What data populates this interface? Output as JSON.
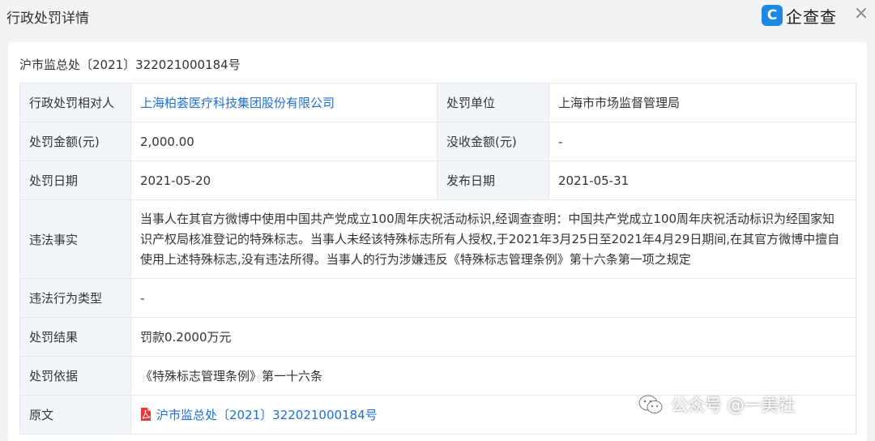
{
  "header": {
    "title": "行政处罚详情",
    "brand_name": "企查查",
    "close_glyph": "×"
  },
  "case_number": "沪市监总处〔2021〕322021000184号",
  "rows": {
    "party_label": "行政处罚相对人",
    "party_value": "上海柏荟医疗科技集团股份有限公司",
    "unit_label": "处罚单位",
    "unit_value": "上海市市场监督管理局",
    "amount_label": "处罚金额(元)",
    "amount_value": "2,000.00",
    "confiscated_label": "没收金额(元)",
    "confiscated_value": "-",
    "date_label": "处罚日期",
    "date_value": "2021-05-20",
    "publish_label": "发布日期",
    "publish_value": "2021-05-31",
    "facts_label": "违法事实",
    "facts_value": "当事人在其官方微博中使用中国共产党成立100周年庆祝活动标识,经调查查明：中国共产党成立100周年庆祝活动标识为经国家知识产权局核准登记的特殊标志。当事人未经该特殊标志所有人授权,于2021年3月25日至2021年4月29日期间,在其官方微博中擅自使用上述特殊标志,没有违法所得。当事人的行为涉嫌违反《特殊标志管理条例》第十六条第一项之规定",
    "type_label": "违法行为类型",
    "type_value": "-",
    "result_label": "处罚结果",
    "result_value": "罚款0.2000万元",
    "basis_label": "处罚依据",
    "basis_value": "《特殊标志管理条例》第一十六条",
    "original_label": "原文",
    "original_value": "沪市监总处〔2021〕322021000184号"
  },
  "watermark": "公众号 @一美社",
  "colors": {
    "accent": "#1e88e5",
    "link": "#1e6fcf",
    "label_bg": "#f2f6fb",
    "pdf": "#e53935"
  },
  "icons": [
    "logo-icon",
    "close-icon",
    "pdf-icon",
    "wechat-icon"
  ]
}
